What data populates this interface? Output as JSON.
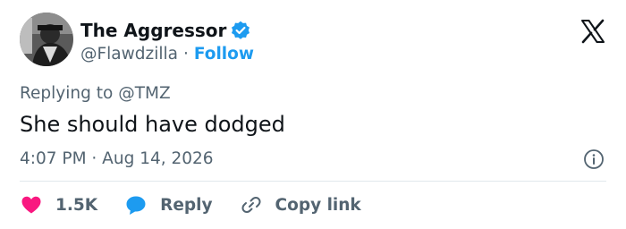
{
  "author": {
    "display_name": "The Aggressor",
    "handle": "@Flawdzilla",
    "separator": "·",
    "follow_label": "Follow",
    "verified_icon": "verified-badge-icon"
  },
  "tweet": {
    "replying_prefix": "Replying to",
    "replying_to": "@TMZ",
    "text": "She should have dodged",
    "timestamp": "4:07 PM · Aug 14, 2026"
  },
  "actions": {
    "likes_count": "1.5K",
    "reply_label": "Reply",
    "copy_link_label": "Copy link"
  },
  "icons": {
    "brand": "x-logo-icon",
    "info": "info-icon",
    "like": "heart-icon",
    "reply": "speech-bubble-icon",
    "copy": "link-icon"
  },
  "colors": {
    "accent": "#1d9bf0",
    "heart": "#f91880",
    "text_primary": "#0f1419",
    "text_secondary": "#536471",
    "divider": "#e1e8ed"
  }
}
